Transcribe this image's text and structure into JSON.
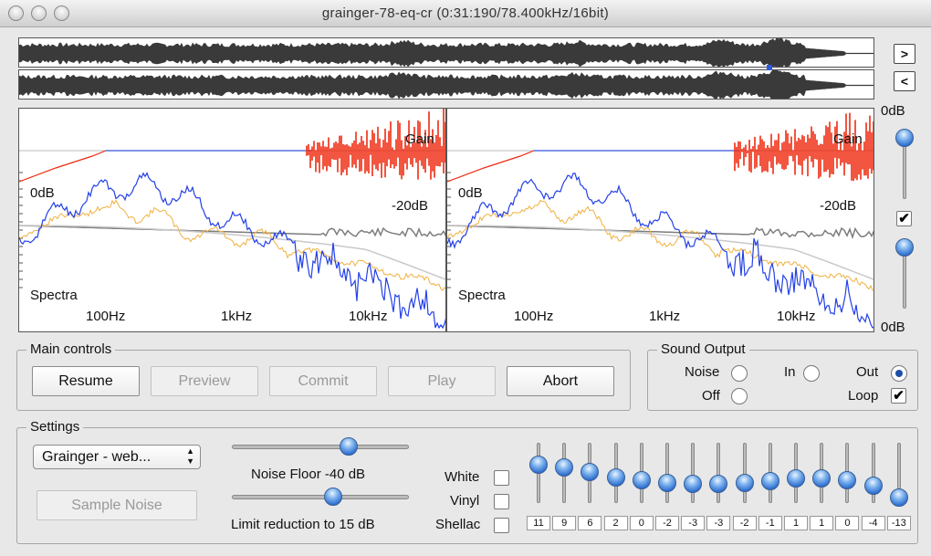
{
  "window": {
    "title": "grainger-78-eq-cr (0:31:190/78.400kHz/16bit)"
  },
  "nav": {
    "next": ">",
    "prev": "<"
  },
  "spectra": {
    "panels": [
      {
        "label_gain": "Gain",
        "label_0db": "0dB",
        "label_m20db": "-20dB",
        "label_spectra": "Spectra"
      },
      {
        "label_gain": "Gain",
        "label_0db": "0dB",
        "label_m20db": "-20dB",
        "label_spectra": "Spectra"
      }
    ],
    "freq_ticks": [
      "100Hz",
      "1kHz",
      "10kHz"
    ],
    "side_top": "0dB",
    "side_bottom": "0dB",
    "curve_colors": {
      "gain_red": "#ee2a10",
      "blue": "#2340e8",
      "orange": "#f0b040",
      "gray": "#888888"
    }
  },
  "main_controls": {
    "legend": "Main controls",
    "buttons": [
      "Resume",
      "Preview",
      "Commit",
      "Play",
      "Abort"
    ],
    "enabled": [
      true,
      false,
      false,
      false,
      true
    ]
  },
  "sound_output": {
    "legend": "Sound Output",
    "noise": "Noise",
    "off": "Off",
    "in": "In",
    "out": "Out",
    "loop": "Loop",
    "selected": "Out",
    "loop_checked": true
  },
  "settings": {
    "legend": "Settings",
    "preset": "Grainger - web...",
    "sample_noise": "Sample Noise",
    "noise_floor": "Noise Floor -40 dB",
    "limit_reduction": "Limit reduction to 15 dB",
    "white": "White",
    "vinyl": "Vinyl",
    "shellac": "Shellac",
    "eq_values": [
      "11",
      "9",
      "6",
      "2",
      "0",
      "-2",
      "-3",
      "-3",
      "-2",
      "-1",
      "1",
      "1",
      "0",
      "-4",
      "-13"
    ]
  }
}
